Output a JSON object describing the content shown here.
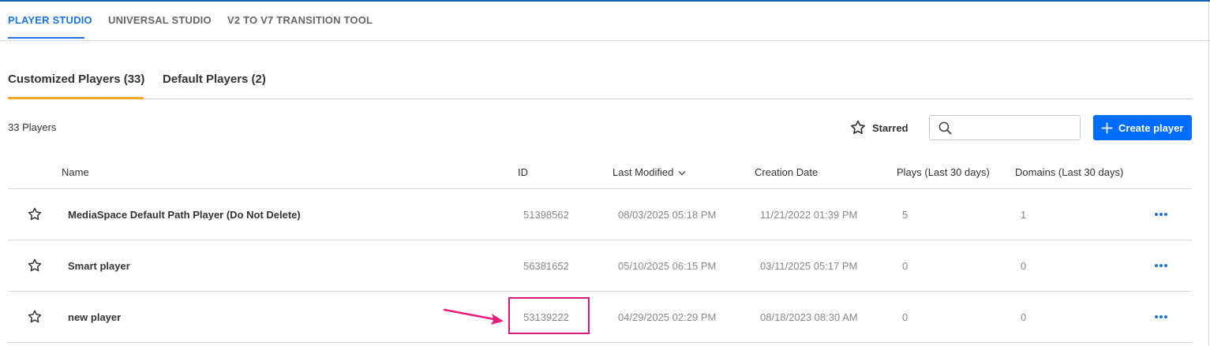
{
  "top_tabs": [
    {
      "label": "PLAYER STUDIO",
      "active": true
    },
    {
      "label": "UNIVERSAL STUDIO",
      "active": false
    },
    {
      "label": "V2 TO V7 TRANSITION TOOL",
      "active": false
    }
  ],
  "sub_tabs": [
    {
      "label": "Customized Players (33)",
      "active": true
    },
    {
      "label": "Default Players (2)",
      "active": false
    }
  ],
  "toolbar": {
    "count_label": "33 Players",
    "starred_label": "Starred",
    "search_placeholder": "",
    "search_value": "",
    "create_label": "Create player"
  },
  "table": {
    "columns": [
      "Name",
      "ID",
      "Last Modified",
      "Creation Date",
      "Plays (Last 30 days)",
      "Domains (Last 30 days)"
    ],
    "sort_column": "Last Modified",
    "rows": [
      {
        "starred": false,
        "name": "MediaSpace Default Path Player (Do Not Delete)",
        "id": "51398562",
        "last_modified": "08/03/2025 05:18 PM",
        "creation_date": "11/21/2022 01:39 PM",
        "plays": "5",
        "domains": "1"
      },
      {
        "starred": false,
        "name": "Smart player",
        "id": "56381652",
        "last_modified": "05/10/2025 06:15 PM",
        "creation_date": "03/11/2025 05:17 PM",
        "plays": "0",
        "domains": "0"
      },
      {
        "starred": false,
        "name": "new player",
        "id": "53139222",
        "last_modified": "04/29/2025 02:29 PM",
        "creation_date": "08/18/2023 08:30 AM",
        "plays": "0",
        "domains": "0"
      }
    ]
  },
  "annotation": {
    "highlighted_cell": "53139222",
    "color": "#d81b7a"
  },
  "colors": {
    "accent": "#1a73e8",
    "primary_button": "#006efa",
    "active_subtab_underline": "#f5a623"
  },
  "icons": [
    "star-outline-icon",
    "search-icon",
    "plus-icon",
    "chevron-down-icon",
    "more-horizontal-icon",
    "arrow-icon"
  ]
}
